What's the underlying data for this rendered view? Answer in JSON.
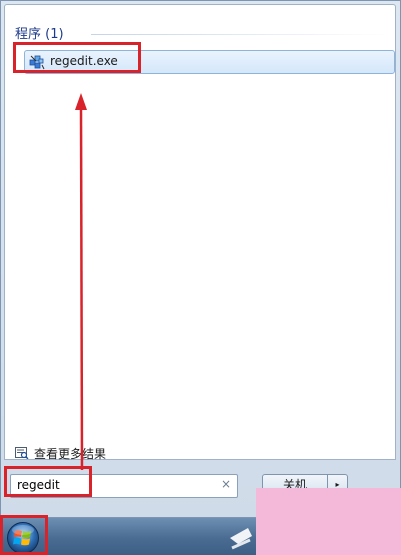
{
  "results": {
    "section_heading": "程序 (1)",
    "program_item": {
      "label": "regedit.exe",
      "icon": "registry-editor-icon"
    },
    "more_results_label": "查看更多结果",
    "more_results_icon": "search-results-icon"
  },
  "search": {
    "value": "regedit",
    "clear_icon": "close-icon",
    "clear_glyph": "×"
  },
  "shutdown": {
    "label": "关机",
    "arrow_icon": "triangle-right-icon",
    "arrow_glyph": "▸"
  },
  "taskbar": {
    "start_icon": "windows-orb-icon"
  },
  "colors": {
    "annotation": "#d9232a",
    "watermark": "#f4b8d8",
    "selection": "#d5e7fa"
  }
}
